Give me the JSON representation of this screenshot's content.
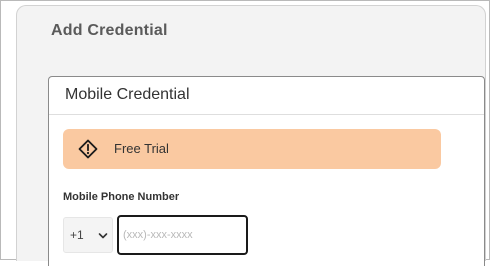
{
  "dialog": {
    "title": "Add Credential"
  },
  "card": {
    "title": "Mobile Credential"
  },
  "banner": {
    "icon": "warning-diamond-icon",
    "text": "Free Trial",
    "color": "#fac9a1"
  },
  "phone": {
    "label": "Mobile Phone Number",
    "country_code": "+1",
    "chevron_icon": "chevron-down-icon",
    "placeholder": "(xxx)-xxx-xxxx",
    "value": ""
  }
}
